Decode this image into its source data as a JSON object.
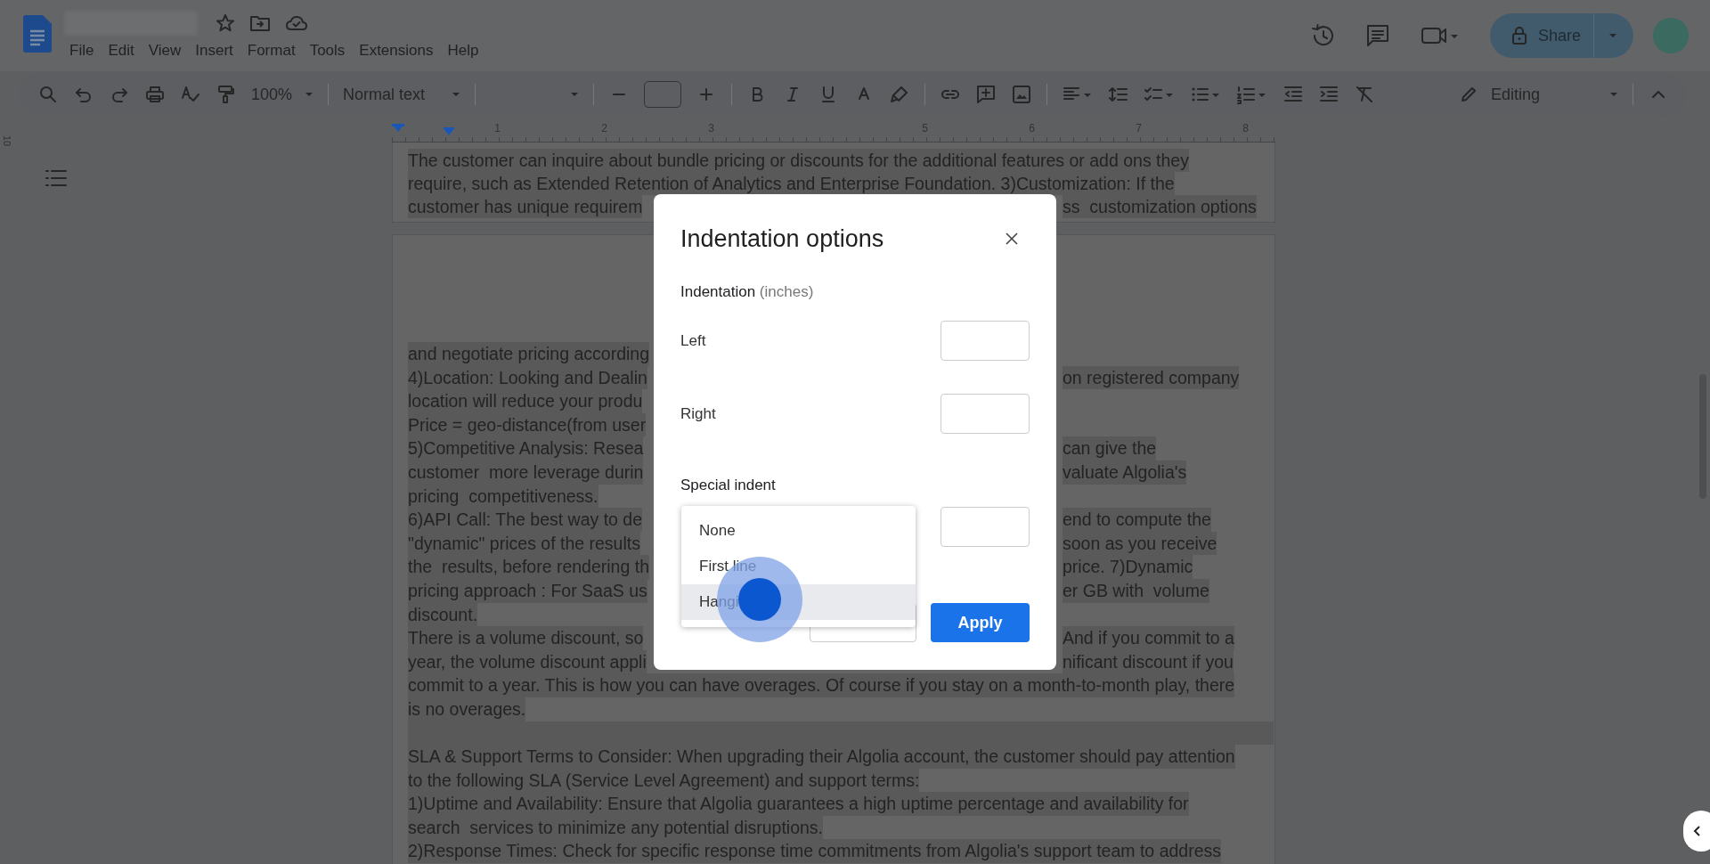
{
  "menu": [
    "File",
    "Edit",
    "View",
    "Insert",
    "Format",
    "Tools",
    "Extensions",
    "Help"
  ],
  "share": {
    "label": "Share"
  },
  "toolbar": {
    "zoom": "100%",
    "style": "Normal text",
    "mode": "Editing"
  },
  "ruler": {
    "side_number": "10",
    "marks": [
      {
        "kind": "number",
        "label": "1"
      },
      {
        "kind": "number",
        "label": "2"
      },
      {
        "kind": "number",
        "label": "3"
      },
      {
        "kind": "gap"
      },
      {
        "kind": "number",
        "label": "5"
      },
      {
        "kind": "number",
        "label": "6"
      },
      {
        "kind": "number",
        "label": "7"
      },
      {
        "kind": "number",
        "label": "8"
      }
    ]
  },
  "pages": [
    {
      "kind": "end",
      "lines": [
        {
          "kind": "text",
          "text": "The customer can inquire about bundle pricing or discounts for the additional features or add ons they"
        },
        {
          "kind": "text",
          "text": "require, such as Extended Retention of Analytics and Enterprise Foundation. 3)Customization: If the"
        },
        {
          "kind": "split",
          "left": "customer has unique requirem",
          "right": "ss  customization options"
        }
      ]
    },
    {
      "kind": "start",
      "lines": [
        {
          "kind": "split",
          "left": "and negotiate pricing according"
        },
        {
          "kind": "split",
          "left": "4)Location: Looking and Dealin",
          "right": "on registered company"
        },
        {
          "kind": "split",
          "left": "location will reduce your produ"
        },
        {
          "kind": "split",
          "left": "Price = geo-distance(from user"
        },
        {
          "kind": "split",
          "left": "5)Competitive Analysis: Resea",
          "right": "can give the"
        },
        {
          "kind": "split",
          "left": "customer  more leverage durin",
          "right": "valuate Algolia's"
        },
        {
          "kind": "split",
          "left": "pricing  competitiveness."
        },
        {
          "kind": "split",
          "left": "6)API Call: The best way to de",
          "right": "end to compute the"
        },
        {
          "kind": "split",
          "left": "\"dynamic\" prices of the results",
          "right": "soon as you receive"
        },
        {
          "kind": "split",
          "left": "the  results, before rendering th",
          "right": "price. 7)Dynamic"
        },
        {
          "kind": "split",
          "left": "pricing approach : For SaaS us",
          "right": "er GB with  volume"
        },
        {
          "kind": "split",
          "left": "discount."
        },
        {
          "kind": "split",
          "left": "There is a volume discount, so",
          "right": "And if you commit to a"
        },
        {
          "kind": "split",
          "left": "year, the volume discount appli",
          "right": "nificant discount if you"
        },
        {
          "kind": "text",
          "text": "commit to a year. This is how you can have overages. Of course if you stay on a month-to-month play, there"
        },
        {
          "kind": "text",
          "text": "is no overages."
        },
        {
          "kind": "blank"
        },
        {
          "kind": "text",
          "text": "SLA & Support Terms to Consider: When upgrading their Algolia account, the customer should pay attention"
        },
        {
          "kind": "text",
          "text": "to the following SLA (Service Level Agreement) and support terms:"
        },
        {
          "kind": "text",
          "text": "1)Uptime and Availability: Ensure that Algolia guarantees a high uptime percentage and availability for"
        },
        {
          "kind": "text",
          "text": "search  services to minimize any potential disruptions."
        },
        {
          "kind": "text",
          "text": "2)Response Times: Check for specific response time commitments from Algolia's support team to address"
        }
      ]
    }
  ],
  "dialog": {
    "title": "Indentation options",
    "heading": "Indentation",
    "unit": "(inches)",
    "fields": [
      {
        "label": "Left"
      },
      {
        "label": "Right"
      }
    ],
    "special_label": "Special indent",
    "options": [
      {
        "label": "None",
        "selected": false
      },
      {
        "label": "First line",
        "selected": false
      },
      {
        "label": "Hangi",
        "selected": true
      }
    ],
    "apply": "Apply"
  }
}
